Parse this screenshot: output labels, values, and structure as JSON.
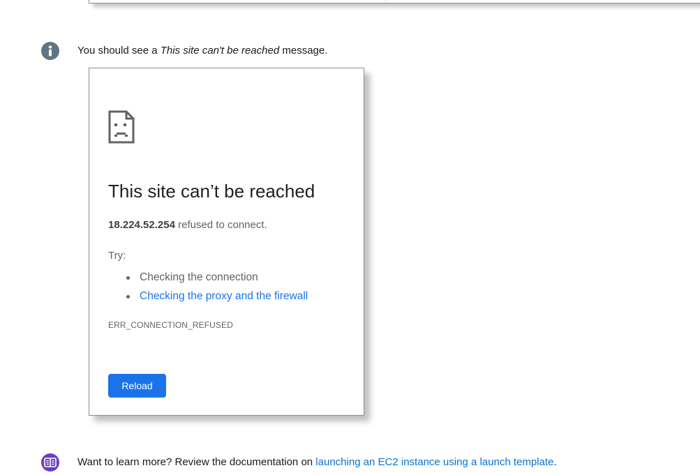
{
  "icons": {
    "info": "info-icon",
    "learn_more": "book-icon",
    "error": "sad-document-icon"
  },
  "colors": {
    "info_icon_bg": "#5f7582",
    "learn_icon_bg": "#6b3fbf",
    "link": "#0972d3",
    "reload_button": "#1a73e8",
    "chrome_link": "#1a73e8"
  },
  "info_callout": {
    "prefix": "You should see a ",
    "emphasis": "This site can't be reached",
    "suffix": " message."
  },
  "error_page": {
    "title": "This site can’t be reached",
    "host": "18.224.52.254",
    "description": " refused to connect.",
    "try_label": "Try:",
    "suggestions": [
      "Checking the connection",
      "Checking the proxy and the firewall"
    ],
    "error_code": "ERR_CONNECTION_REFUSED",
    "reload_label": "Reload"
  },
  "learn_more": {
    "prefix": "Want to learn more? Review the documentation on ",
    "link_text": "launching an EC2 instance using a launch template",
    "suffix": "."
  }
}
